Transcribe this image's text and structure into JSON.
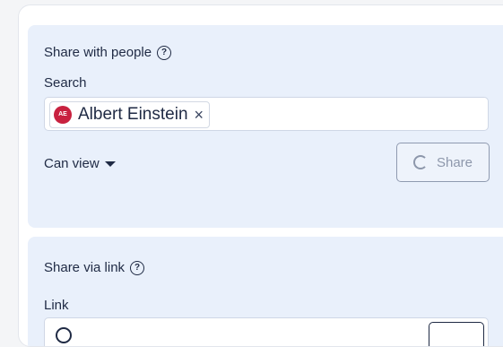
{
  "share_people": {
    "heading": "Share with people",
    "search_label": "Search",
    "chip": {
      "initials": "AE",
      "name": "Albert Einstein",
      "remove": "×"
    },
    "permission": "Can view",
    "share_button": "Share"
  },
  "share_link": {
    "heading": "Share via link",
    "link_label": "Link"
  },
  "colors": {
    "avatar": "#c8213f",
    "panel": "#e9f0fb",
    "text": "#1f2a44"
  }
}
